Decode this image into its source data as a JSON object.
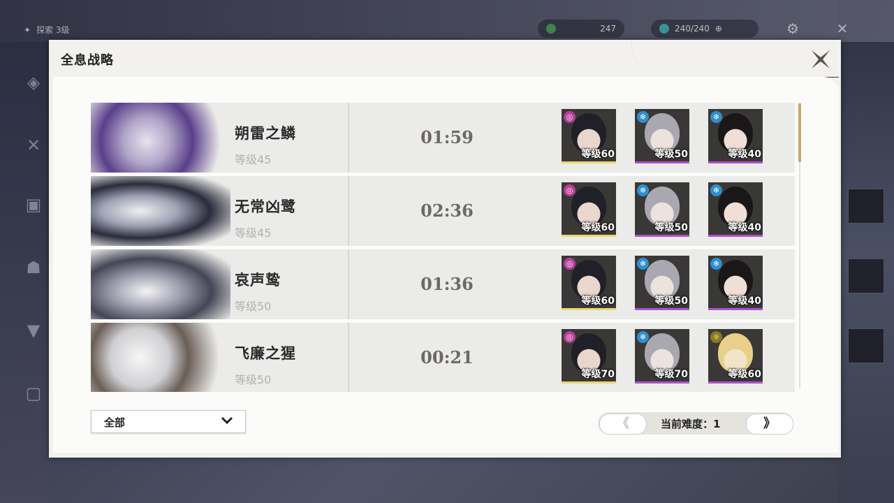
{
  "background_hud": {
    "top_left_label": "探索 3级",
    "currency1": "247",
    "currency2": "240/240"
  },
  "dialog": {
    "title": "全息战略"
  },
  "rows": [
    {
      "boss_name": "朔雷之鳞",
      "boss_level": "等级45",
      "clear_time": "01:59",
      "team": [
        {
          "level": "等级60",
          "attr_icon": "spectro-icon",
          "attr_color": "#b8409a",
          "bar_color": "#e8d870"
        },
        {
          "level": "等级50",
          "attr_icon": "glacio-icon",
          "attr_color": "#2f8fd0",
          "bar_color": "#b050d0"
        },
        {
          "level": "等级40",
          "attr_icon": "glacio-icon",
          "attr_color": "#2f8fd0",
          "bar_color": "#b050d0"
        }
      ]
    },
    {
      "boss_name": "无常凶鹭",
      "boss_level": "等级45",
      "clear_time": "02:36",
      "team": [
        {
          "level": "等级60",
          "attr_icon": "spectro-icon",
          "attr_color": "#b8409a",
          "bar_color": "#e8d870"
        },
        {
          "level": "等级50",
          "attr_icon": "glacio-icon",
          "attr_color": "#2f8fd0",
          "bar_color": "#b050d0"
        },
        {
          "level": "等级40",
          "attr_icon": "glacio-icon",
          "attr_color": "#2f8fd0",
          "bar_color": "#b050d0"
        }
      ]
    },
    {
      "boss_name": "哀声鸷",
      "boss_level": "等级50",
      "clear_time": "01:36",
      "team": [
        {
          "level": "等级60",
          "attr_icon": "spectro-icon",
          "attr_color": "#b8409a",
          "bar_color": "#e8d870"
        },
        {
          "level": "等级50",
          "attr_icon": "glacio-icon",
          "attr_color": "#2f8fd0",
          "bar_color": "#b050d0"
        },
        {
          "level": "等级40",
          "attr_icon": "glacio-icon",
          "attr_color": "#2f8fd0",
          "bar_color": "#b050d0"
        }
      ]
    },
    {
      "boss_name": "飞廉之猩",
      "boss_level": "等级50",
      "clear_time": "00:21",
      "team": [
        {
          "level": "等级70",
          "attr_icon": "spectro-icon",
          "attr_color": "#b8409a",
          "bar_color": "#e8d870"
        },
        {
          "level": "等级70",
          "attr_icon": "glacio-icon",
          "attr_color": "#2f8fd0",
          "bar_color": "#b050d0"
        },
        {
          "level": "等级60",
          "attr_icon": "sun-icon",
          "attr_color": "#8a7a20",
          "bar_color": "#b050d0"
        }
      ]
    }
  ],
  "filter": {
    "selected": "全部"
  },
  "pager": {
    "prev": "《",
    "next": "》",
    "label": "当前难度：1"
  }
}
